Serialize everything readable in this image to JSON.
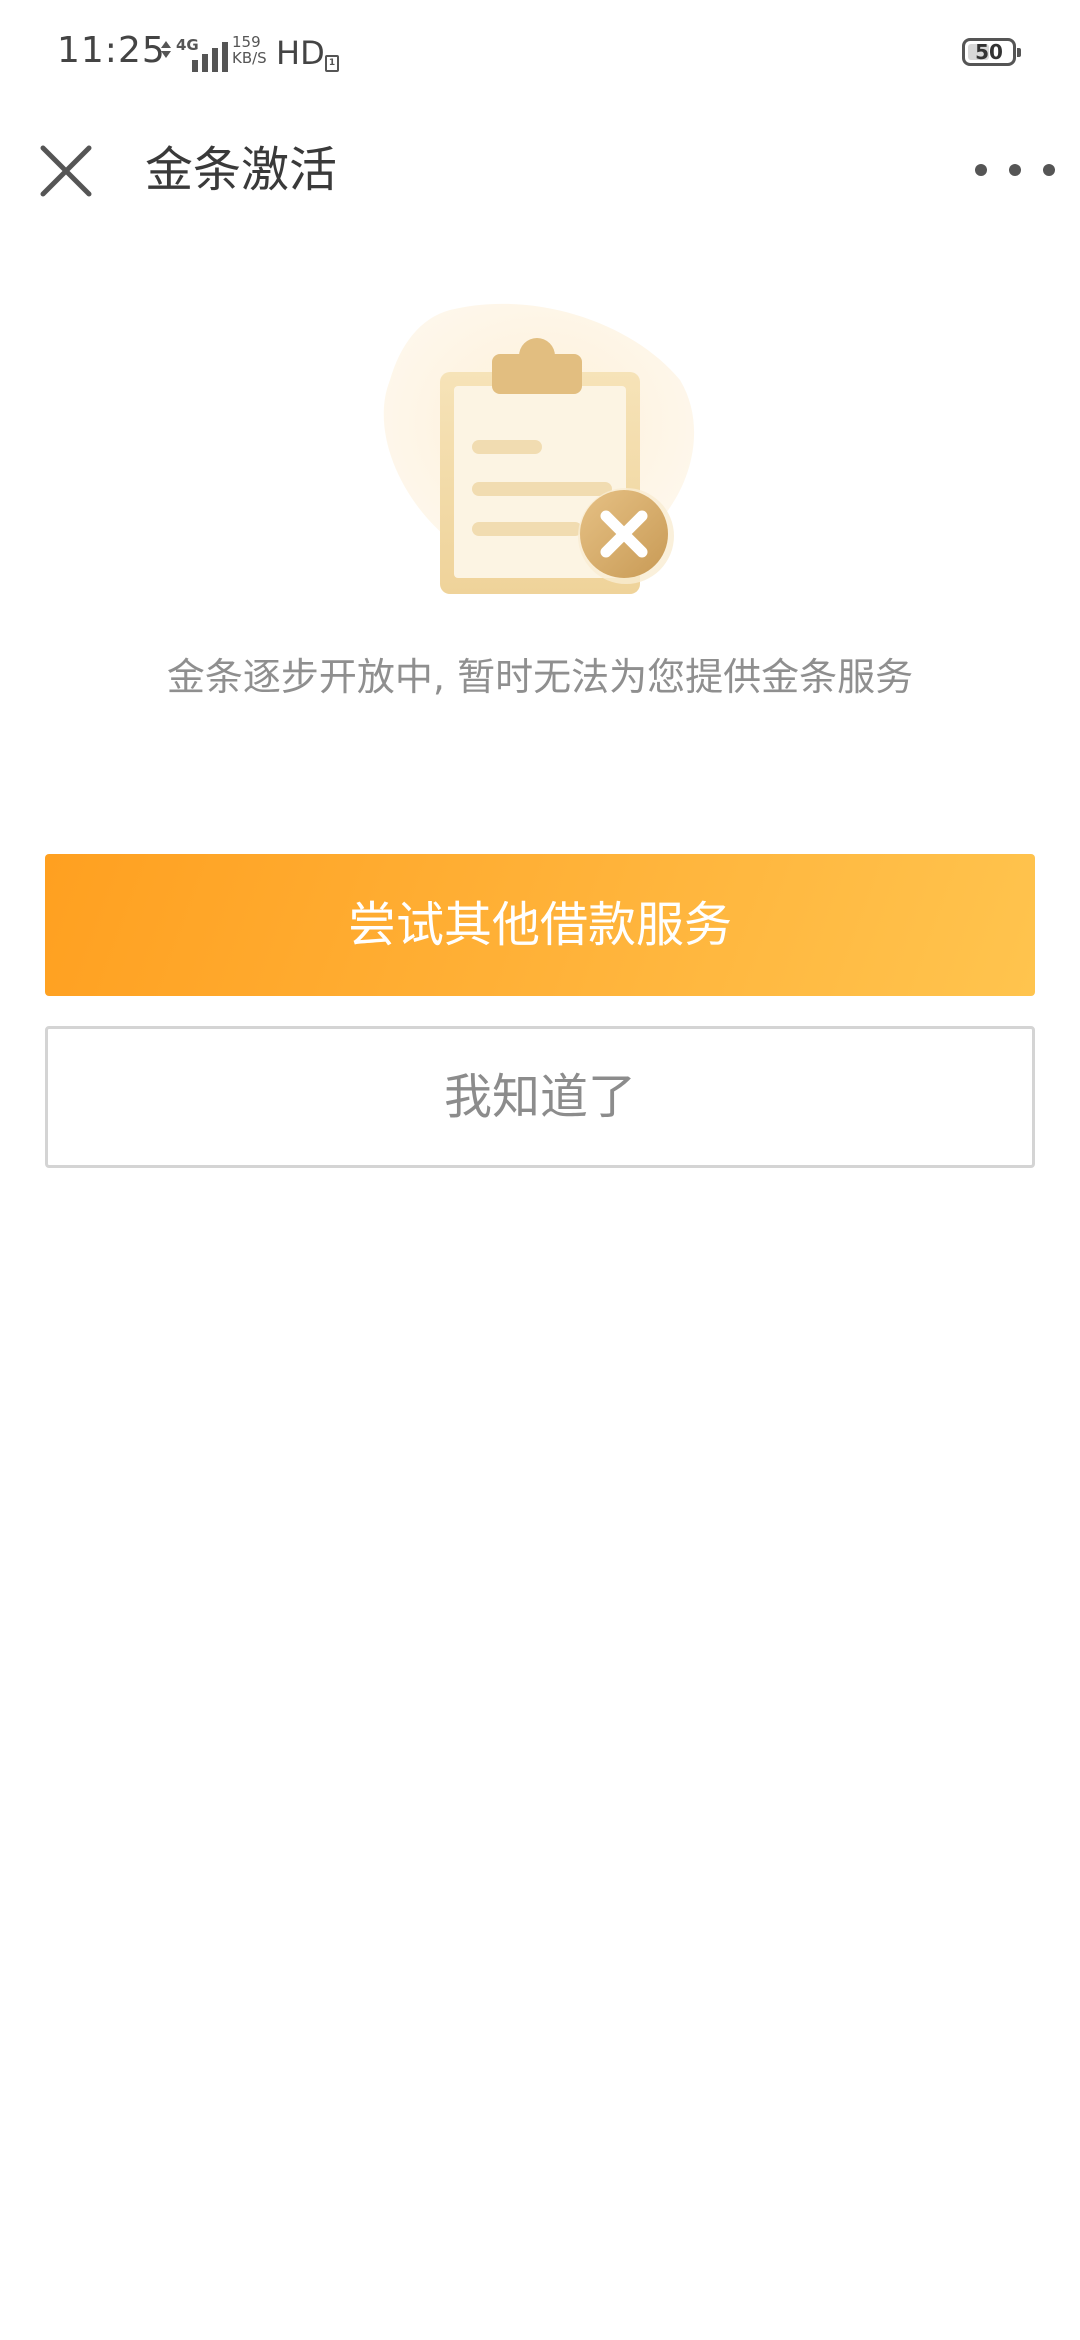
{
  "status_bar": {
    "time": "11:25",
    "network_type": "4G",
    "speed_value": "159",
    "speed_unit": "KB/S",
    "hd_label": "HD",
    "hd_sub": "1",
    "battery_level": "50",
    "battery_fraction": 0.5
  },
  "header": {
    "title": "金条激活",
    "close_icon": "close-icon",
    "more_icon": "more-icon"
  },
  "illustration": {
    "icon": "clipboard-error-icon",
    "colors": {
      "blob": "#fdf3e1",
      "board": "#f6e2b6",
      "border": "#dcb572",
      "badge": "#d7aa68"
    }
  },
  "message": {
    "text": "金条逐步开放中, 暂时无法为您提供金条服务"
  },
  "buttons": {
    "primary_label": "尝试其他借款服务",
    "secondary_label": "我知道了"
  },
  "colors": {
    "primary_start": "#ffa020",
    "primary_end": "#ffc44e",
    "message_text": "#8f8f8f"
  }
}
